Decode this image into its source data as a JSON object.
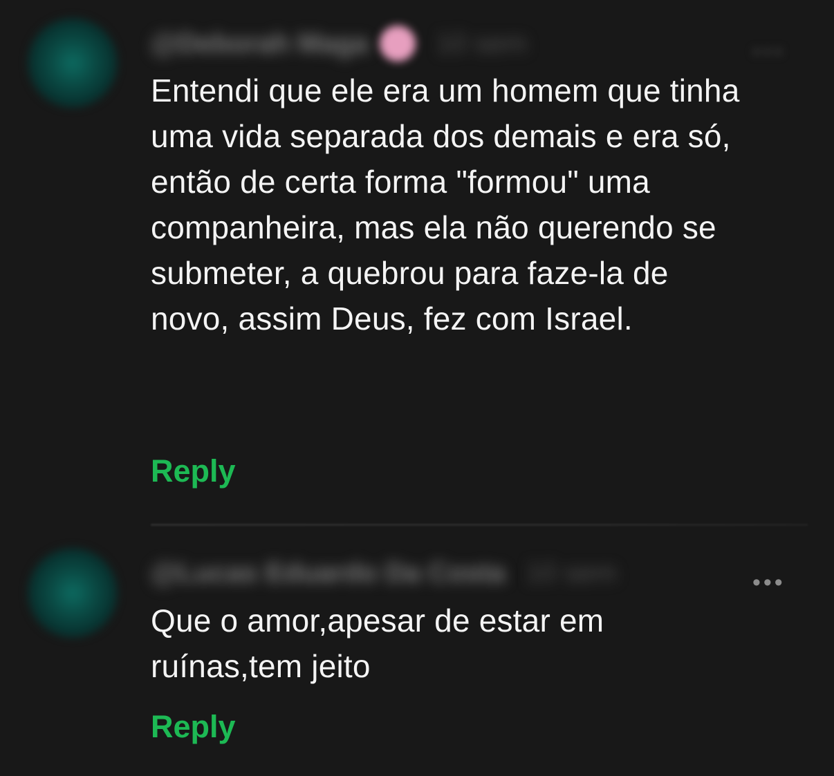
{
  "comments": [
    {
      "username": "@Deborah Maga",
      "time": "10 sem",
      "text": "Entendi que ele era um homem que tinha uma vida separada dos demais e era só,  então de certa forma \"formou\" uma companheira, mas ela não querendo se submeter, a quebrou para faze-la de novo, assim Deus, fez com Israel.",
      "reply_label": "Reply",
      "more_icon": "•••"
    },
    {
      "username": "@Lucas Eduardo Da Costa",
      "time": "10 sem",
      "text": "Que o amor,apesar de estar em ruínas,tem jeito",
      "reply_label": "Reply",
      "more_icon": "•••"
    }
  ],
  "colors": {
    "background": "#181818",
    "text": "#f4f4f4",
    "reply": "#1db954",
    "avatar": "#0d6a60",
    "badge": "#e79fbf"
  },
  "icons": {
    "avatar": "avatar",
    "verified": "verified-badge-icon",
    "more": "more-options-icon"
  }
}
